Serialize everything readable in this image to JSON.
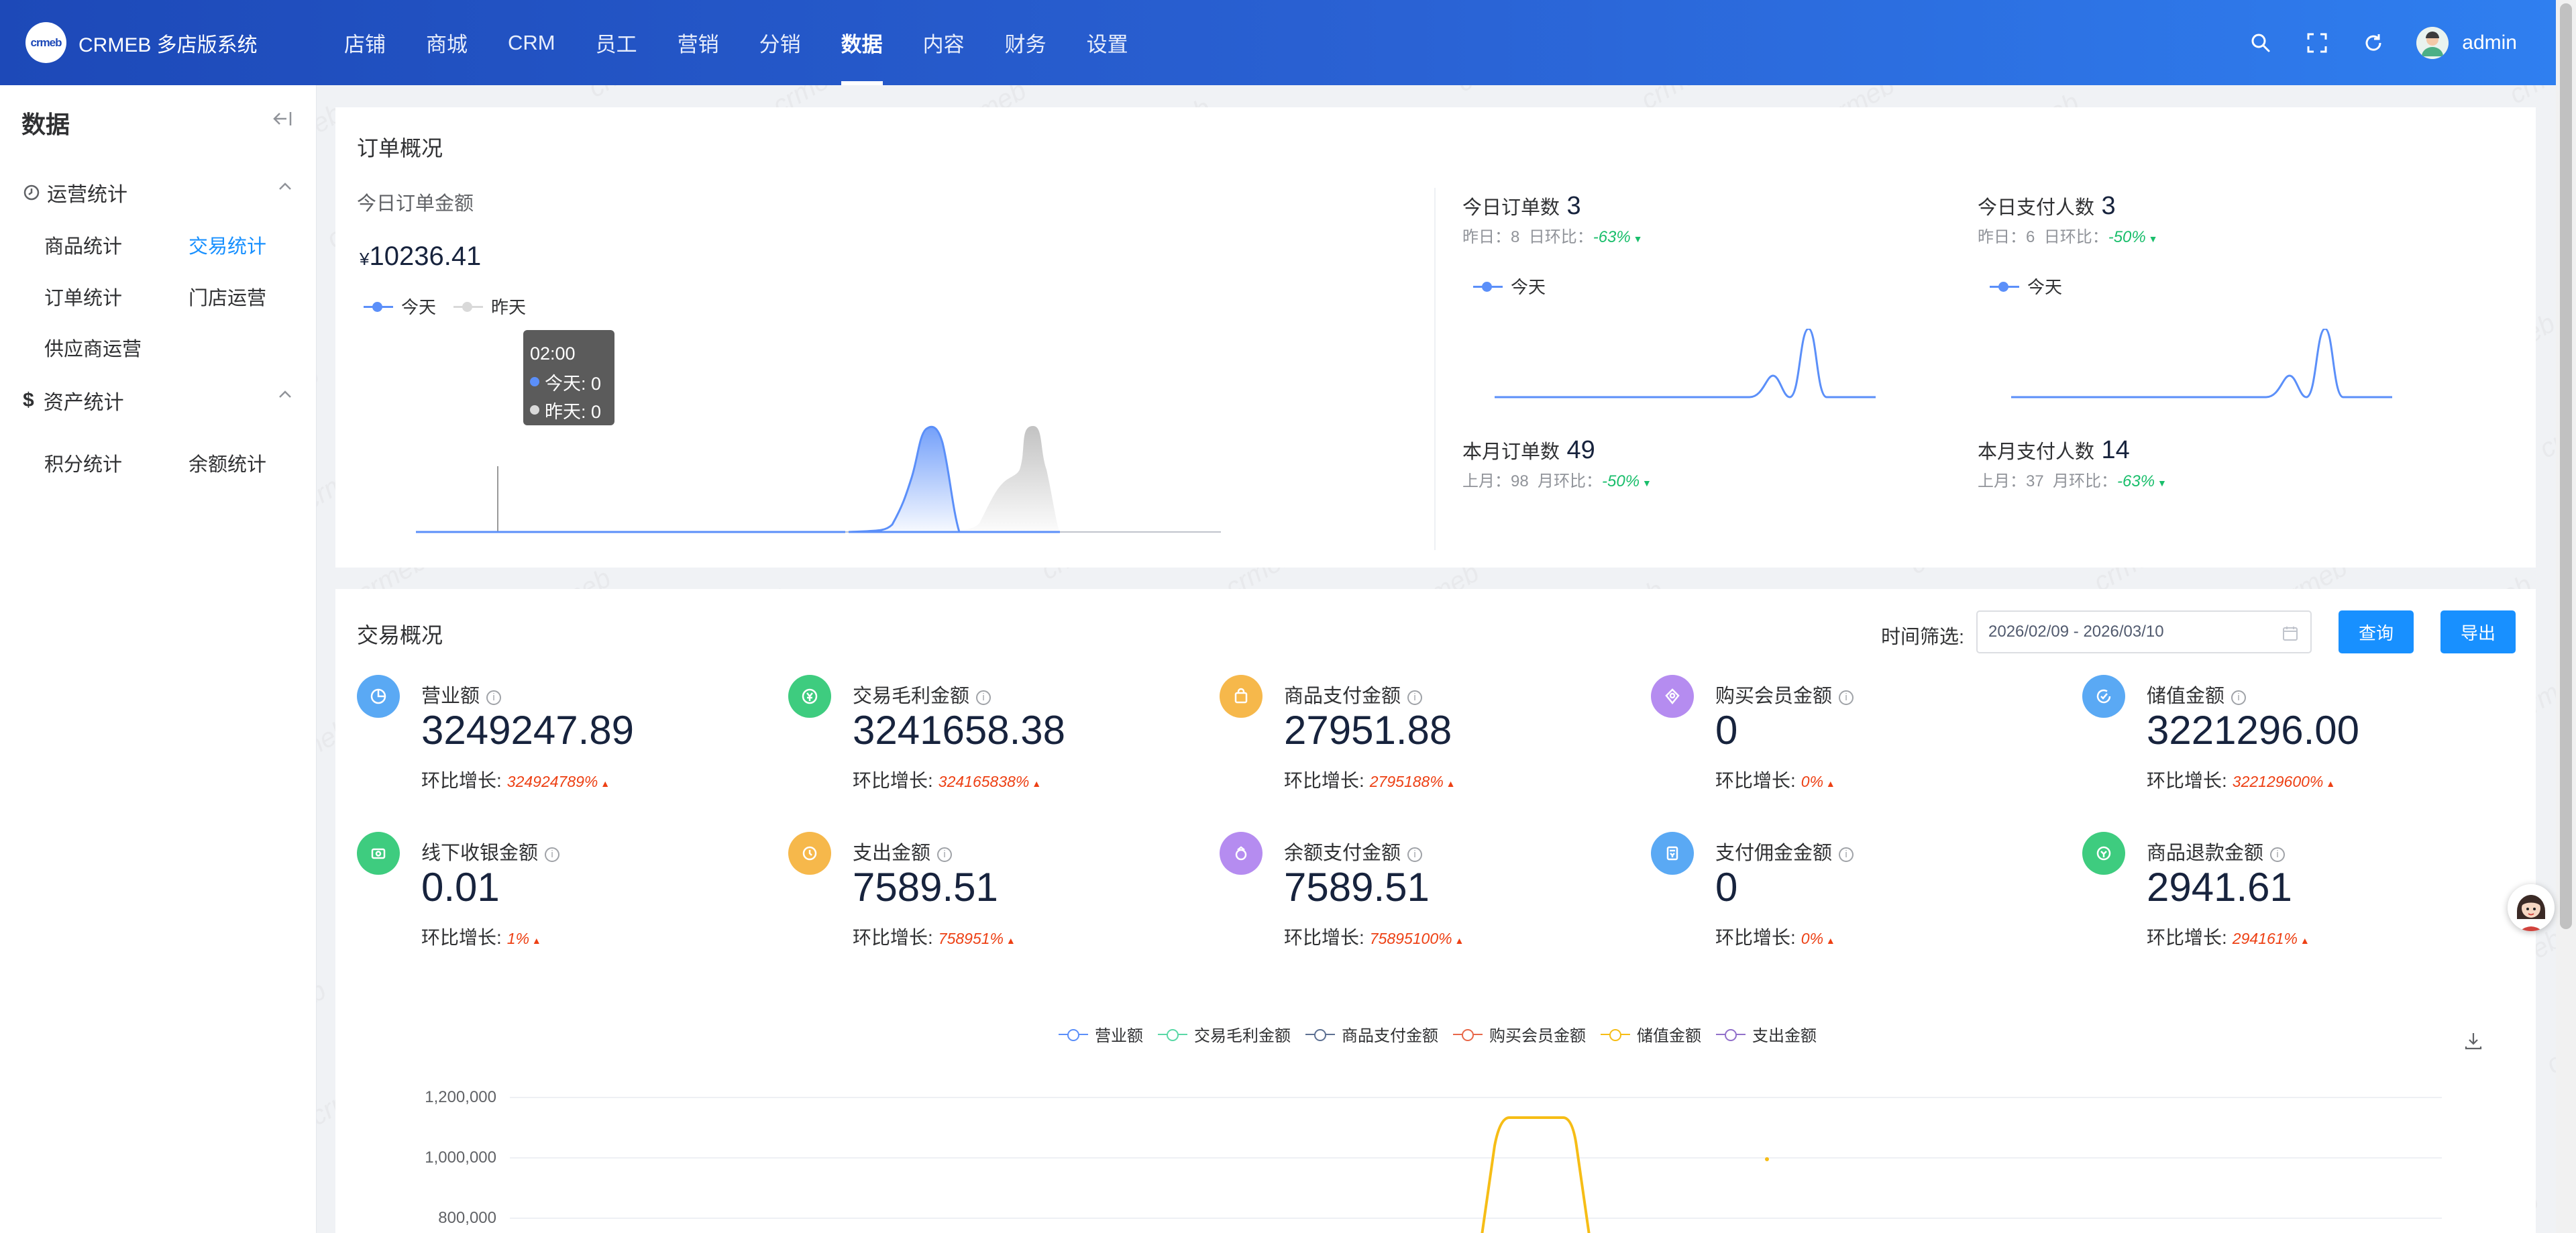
{
  "header": {
    "logo_mark": "crmeb",
    "brand": "CRMEB 多店版系统",
    "nav": [
      "店铺",
      "商城",
      "CRM",
      "员工",
      "营销",
      "分销",
      "数据",
      "内容",
      "财务",
      "设置"
    ],
    "active_nav_index": 6,
    "icons": [
      "search-icon",
      "fullscreen-icon",
      "refresh-icon"
    ],
    "username": "admin"
  },
  "sidebar": {
    "title": "数据",
    "groups": [
      {
        "label": "运营统计",
        "icon": "clock-icon",
        "items": [
          "商品统计",
          "交易统计",
          "订单统计",
          "门店运营",
          "供应商运营"
        ]
      },
      {
        "label": "资产统计",
        "icon": "dollar-icon",
        "items": [
          "积分统计",
          "余额统计"
        ]
      }
    ],
    "active_item": "交易统计"
  },
  "order_overview": {
    "title": "订单概况",
    "amount_label": "今日订单金额",
    "currency": "¥",
    "amount": "10236.41",
    "legend": [
      "今天",
      "昨天"
    ],
    "tooltip": {
      "time": "02:00",
      "today": "今天: 0",
      "yesterday": "昨天: 0"
    },
    "mini_cards": [
      {
        "label": "今日订单数",
        "value": "3",
        "prev_label": "昨日：",
        "prev": "8",
        "ratio_label": "日环比：",
        "ratio": "-63%",
        "legend": "今天"
      },
      {
        "label": "今日支付人数",
        "value": "3",
        "prev_label": "昨日：",
        "prev": "6",
        "ratio_label": "日环比：",
        "ratio": "-50%",
        "legend": "今天"
      },
      {
        "label": "本月订单数",
        "value": "49",
        "prev_label": "上月：",
        "prev": "98",
        "ratio_label": "月环比：",
        "ratio": "-50%"
      },
      {
        "label": "本月支付人数",
        "value": "14",
        "prev_label": "上月：",
        "prev": "37",
        "ratio_label": "月环比：",
        "ratio": "-63%"
      }
    ]
  },
  "trade_overview": {
    "title": "交易概况",
    "filter_label": "时间筛选:",
    "date_range": "2026/02/09 - 2026/03/10",
    "query_button": "查询",
    "export_button": "导出",
    "growth_label": "环比增长:",
    "stats": [
      {
        "label": "营业额",
        "value": "3249247.89",
        "growth": "324924789%",
        "color": "#5aa9f4",
        "icon": "pie-chart-icon"
      },
      {
        "label": "交易毛利金额",
        "value": "3241658.38",
        "growth": "324165838%",
        "color": "#3ecc7f",
        "icon": "money-icon"
      },
      {
        "label": "商品支付金额",
        "value": "27951.88",
        "growth": "2795188%",
        "color": "#f6b84b",
        "icon": "bag-icon"
      },
      {
        "label": "购买会员金额",
        "value": "0",
        "growth": "0%",
        "color": "#b58cf0",
        "icon": "vip-icon"
      },
      {
        "label": "储值金额",
        "value": "3221296.00",
        "growth": "322129600%",
        "color": "#5aa9f4",
        "icon": "recharge-icon"
      },
      {
        "label": "线下收银金额",
        "value": "0.01",
        "growth": "1%",
        "color": "#3ecc7f",
        "icon": "cash-icon"
      },
      {
        "label": "支出金额",
        "value": "7589.51",
        "growth": "758951%",
        "color": "#f6b84b",
        "icon": "expense-icon"
      },
      {
        "label": "余额支付金额",
        "value": "7589.51",
        "growth": "75895100%",
        "color": "#b58cf0",
        "icon": "wallet-icon"
      },
      {
        "label": "支付佣金金额",
        "value": "0",
        "growth": "0%",
        "color": "#5aa9f4",
        "icon": "commission-icon"
      },
      {
        "label": "商品退款金额",
        "value": "2941.61",
        "growth": "294161%",
        "color": "#3ecc7f",
        "icon": "refund-icon"
      }
    ],
    "chart_legend": [
      {
        "name": "营业额",
        "color": "#5b8ff9"
      },
      {
        "name": "交易毛利金额",
        "color": "#5ad8a6"
      },
      {
        "name": "商品支付金额",
        "color": "#5d7092"
      },
      {
        "name": "购买会员金额",
        "color": "#e8684a"
      },
      {
        "name": "储值金额",
        "color": "#f6bd16"
      },
      {
        "name": "支出金额",
        "color": "#9270ca"
      }
    ],
    "y_ticks": [
      "1,200,000",
      "1,000,000",
      "800,000"
    ]
  }
}
